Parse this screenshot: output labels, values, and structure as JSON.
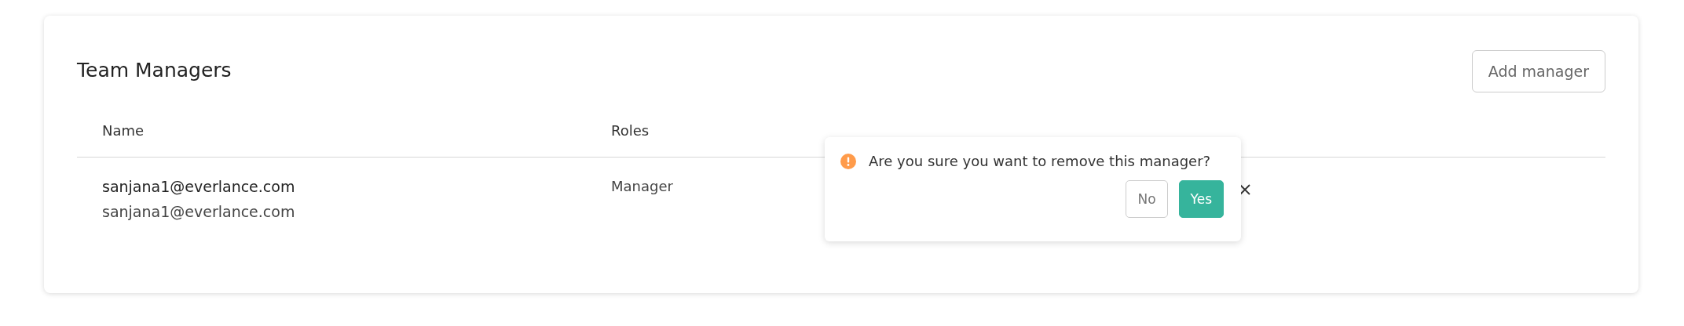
{
  "card": {
    "title": "Team Managers",
    "add_button": "Add manager"
  },
  "table": {
    "columns": [
      "Name",
      "Roles"
    ],
    "rows": [
      {
        "name": "sanjana1@everlance.com",
        "email": "sanjana1@everlance.com",
        "role": "Manager"
      }
    ]
  },
  "popconfirm": {
    "message": "Are you sure you want to remove this manager?",
    "buttons": [
      {
        "label": "No",
        "kind": "default"
      },
      {
        "label": "Yes",
        "kind": "primary"
      }
    ]
  }
}
